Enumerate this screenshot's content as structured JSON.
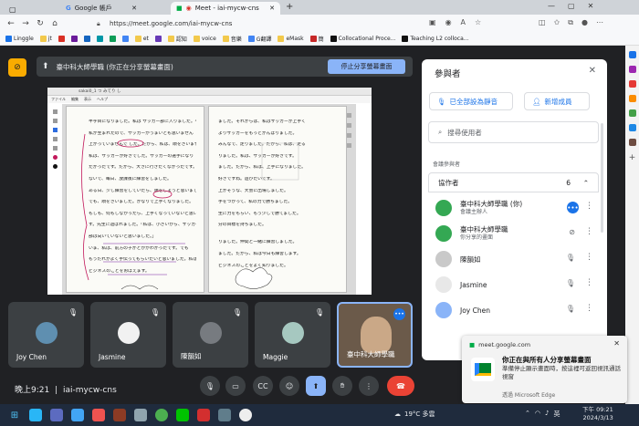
{
  "browser": {
    "tabs": [
      {
        "label": "Google 帳戶",
        "active": false
      },
      {
        "label": "Meet - iai-mycw-cns",
        "active": true
      }
    ],
    "url": "https://meet.google.com/iai-mycw-cns",
    "bookmarks": [
      "Linggle",
      "jt",
      "et",
      "認知",
      "voice",
      "音樂",
      "G翻譯",
      "eMask",
      "簡",
      "Collocational Proce...",
      "Teaching L2 colloca..."
    ]
  },
  "meet": {
    "share_banner_text": "臺中科大師學職 (你正在分享螢幕畫面)",
    "stop_share_label": "停止分享螢幕畫面",
    "time": "晚上9:21",
    "separator": "|",
    "meeting_code": "iai-mycw-cns"
  },
  "shared_document": {
    "app_title": "sakai0_1 つ みてり し",
    "menu": [
      "ファイル",
      "編集",
      "表示",
      "ヘルプ"
    ],
    "left_lines": [
      "半字目になりました。私は サッカー部に入りました。平和部に",
      "私が生まれたので、サッカーがうまいとも思いません",
      "上がっていませんで した。だから、私は、頑をさいませんでした",
      "私は、サッカーが好きでした。サッカーの選手になり",
      "たかったです。だから、大きに行きたくなかったです。だ",
      "ないで、毎日、放課後に練習をしました。",
      "ある日、少し練習をしていたら、頑をしようと思いました。",
      "でも、頑をさいました。かなりで上手くなりました。",
      "もしも、何もしなかったら、上手くなっていないと思いま",
      "す。先生に遊ばれました。「私は、小さいから、サッカー",
      "部は向いていないと思いました。」",
      "いま、私は、前方の子かとかがわかったです。でも",
      "もうだれかよく手伝ってもらいたいと思いました。私は",
      "ビジネスのことをおぼえます。"
    ],
    "right_lines": [
      "ました。それからは、私はサッカーが上手く",
      "よりサッカーをもっとがんばりました。",
      "みんなで、走りました。だから、私は、走る",
      "りました。私は、サッカーが好きです。",
      "ました。だから、私は、上手になりました。",
      "好きですね。遊びたいです。",
      "上かそうな、大会に出場しました。",
      "手をつかって、私の力で勝ちました。",
      "生に力をもらい、もう少しで勝てました。",
      "分の目標を持ちました。",
      "",
      "りました。仲間と一緒に練習しました。",
      "ました。だから、私は今日も練習します。",
      "ビジネスのことをよく知りました。"
    ]
  },
  "participants_panel": {
    "title": "參與者",
    "mute_all_label": "已全部設為靜音",
    "add_person_label": "新增成員",
    "search_placeholder": "搜尋使用者",
    "section_label": "會議參與者",
    "group_label": "協作者",
    "group_count": "6",
    "people": [
      {
        "name": "臺中科大師學職 (你)",
        "sub": "會議主辦人",
        "avatar_color": "#34a853"
      },
      {
        "name": "臺中科大師學職",
        "sub": "你分享的畫面",
        "avatar_color": "#34a853"
      },
      {
        "name": "陳韻如",
        "sub": "",
        "avatar_color": "#c9c9c9"
      },
      {
        "name": "Jasmine",
        "sub": "",
        "avatar_color": "#e8e8e8"
      },
      {
        "name": "Joy Chen",
        "sub": "",
        "avatar_color": "#8ab4f8"
      }
    ]
  },
  "tiles": [
    {
      "name": "Joy Chen",
      "color": "#5f8fb0"
    },
    {
      "name": "Jasmine",
      "color": "#f1f1f1"
    },
    {
      "name": "陳韻如",
      "color": "#777b80"
    },
    {
      "name": "Maggie",
      "color": "#a6c8c0"
    },
    {
      "name": "臺中科大師學職",
      "color": "#caa887"
    }
  ],
  "notification": {
    "source": "meet.google.com",
    "title": "你正在與所有人分享螢幕畫面",
    "body": "準備停止顯示畫面時，按這裡可返回視訊通話視窗",
    "via": "透過 Microsoft Edge"
  },
  "taskbar": {
    "weather": "19°C 多雲",
    "lang": "英",
    "clock_time": "下午 09:21",
    "clock_date": "2024/3/13"
  },
  "colors": {
    "accent": "#8ab4f8",
    "hangup": "#ea4335",
    "present": "#f9ab00",
    "bg": "#202124"
  }
}
